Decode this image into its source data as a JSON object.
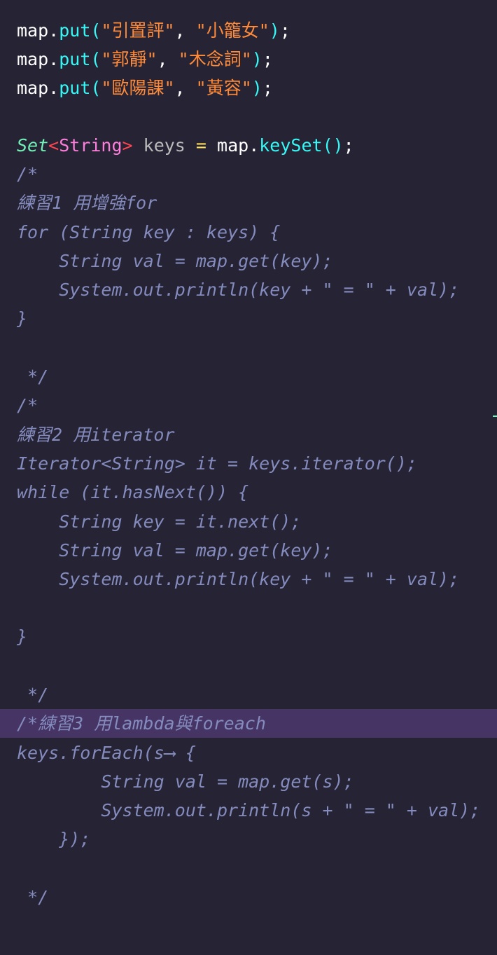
{
  "editor": {
    "lines": [
      {
        "id": "put-1",
        "parts": [
          "map",
          ".",
          "put",
          "(",
          "\"引置評\"",
          ", ",
          "\"小籠女\"",
          ")",
          ";"
        ]
      },
      {
        "id": "put-2",
        "parts": [
          "map",
          ".",
          "put",
          "(",
          "\"郭靜\"",
          ", ",
          "\"木念詞\"",
          ")",
          ";"
        ]
      },
      {
        "id": "put-3",
        "parts": [
          "map",
          ".",
          "put",
          "(",
          "\"歐陽課\"",
          ", ",
          "\"黃容\"",
          ")",
          ";"
        ]
      },
      {
        "id": "keys-decl",
        "parts": [
          "Set",
          "<",
          "String",
          ">",
          " keys ",
          "=",
          " map",
          ".",
          "keySet",
          "()",
          ";"
        ]
      },
      {
        "id": "c1-open",
        "text": "/*"
      },
      {
        "id": "c1-title",
        "text": "練習1 用增強for"
      },
      {
        "id": "c1-for",
        "text": "for (String key : keys) {"
      },
      {
        "id": "c1-get",
        "text": "    String val = map.get(key);"
      },
      {
        "id": "c1-print",
        "text": "    System.out.println(key + \" = \" + val);"
      },
      {
        "id": "c1-brace",
        "text": "}"
      },
      {
        "id": "c1-close",
        "text": " */"
      },
      {
        "id": "c2-open",
        "text": "/*"
      },
      {
        "id": "c2-title",
        "text": "練習2 用iterator"
      },
      {
        "id": "c2-iter",
        "text": "Iterator<String> it = keys.iterator();"
      },
      {
        "id": "c2-while",
        "text": "while (it.hasNext()) {"
      },
      {
        "id": "c2-next",
        "text": "    String key = it.next();"
      },
      {
        "id": "c2-get",
        "text": "    String val = map.get(key);"
      },
      {
        "id": "c2-print",
        "text": "    System.out.println(key + \" = \" + val);"
      },
      {
        "id": "c2-brace",
        "text": "}"
      },
      {
        "id": "c2-close",
        "text": " */"
      },
      {
        "id": "c3-title",
        "text": "/*練習3 用lambda與foreach"
      },
      {
        "id": "c3-foreach",
        "text": "keys.forEach(s⟶ {"
      },
      {
        "id": "c3-get",
        "text": "        String val = map.get(s);"
      },
      {
        "id": "c3-print",
        "text": "        System.out.println(s + \" = \" + val);"
      },
      {
        "id": "c3-end",
        "text": "    });"
      },
      {
        "id": "c3-close",
        "text": " */"
      }
    ]
  },
  "colors": {
    "background": "#262335",
    "highlight": "#463465",
    "comment": "#848bbd",
    "function": "#36f9f6",
    "string": "#ff8b39",
    "type": "#72f1b8",
    "keyword": "#ff7edb",
    "operator": "#fede5d"
  }
}
